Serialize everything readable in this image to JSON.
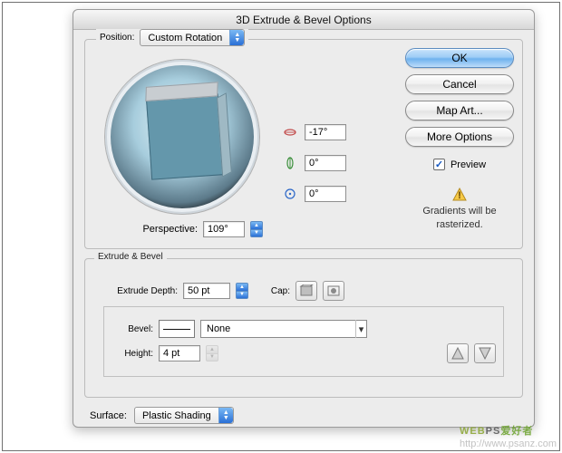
{
  "dialog": {
    "title": "3D Extrude & Bevel Options"
  },
  "position": {
    "label": "Position:",
    "preset": "Custom Rotation",
    "rotation_x": "-17°",
    "rotation_y": "0°",
    "rotation_z": "0°",
    "perspective_label": "Perspective:",
    "perspective_value": "109°"
  },
  "extrude_bevel": {
    "legend": "Extrude & Bevel",
    "depth_label": "Extrude Depth:",
    "depth_value": "50 pt",
    "cap_label": "Cap:",
    "bevel_label": "Bevel:",
    "bevel_value": "None",
    "height_label": "Height:",
    "height_value": "4 pt"
  },
  "surface": {
    "label": "Surface:",
    "value": "Plastic Shading"
  },
  "buttons": {
    "ok": "OK",
    "cancel": "Cancel",
    "map_art": "Map Art...",
    "more_options": "More Options",
    "preview": "Preview"
  },
  "warning": {
    "line1": "Gradients will be",
    "line2": "rasterized."
  },
  "watermark": {
    "brand": "WEBPS爱好者",
    "url": "http://www.psanz.com"
  }
}
